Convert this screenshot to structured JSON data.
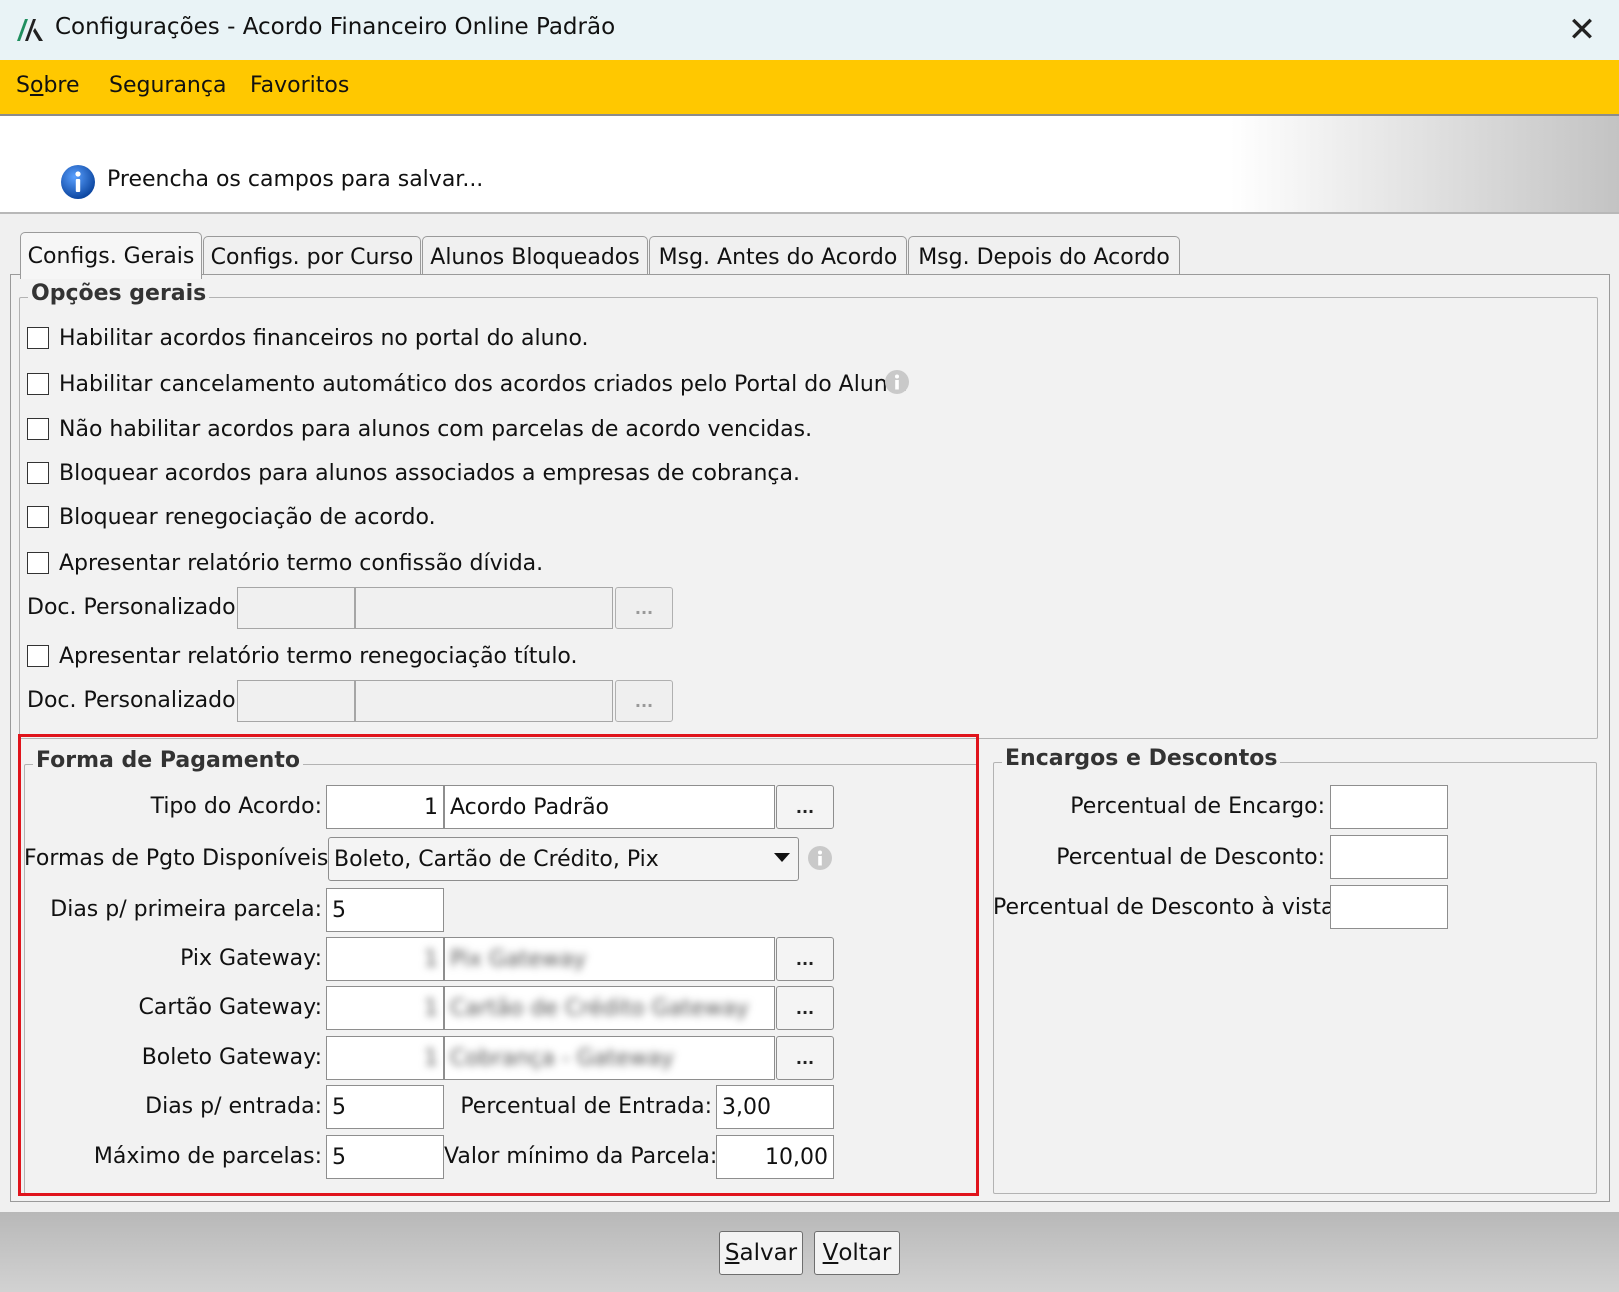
{
  "window": {
    "title": "Configurações - Acordo Financeiro Online Padrão",
    "close_glyph": "✕"
  },
  "menu": {
    "items": [
      {
        "pre": "S",
        "ul": "o",
        "post": "bre"
      },
      {
        "pre": "",
        "ul": "",
        "post": "Segurança"
      },
      {
        "pre": "",
        "ul": "",
        "post": "Favoritos"
      }
    ]
  },
  "banner": {
    "text": "Preencha os campos para salvar..."
  },
  "tabs": [
    {
      "label": "Configs. Gerais"
    },
    {
      "label": "Configs. por Curso"
    },
    {
      "label": "Alunos Bloqueados"
    },
    {
      "label": "Msg. Antes do Acordo"
    },
    {
      "label": "Msg. Depois do Acordo"
    }
  ],
  "opcoes_gerais": {
    "legend": "Opções gerais",
    "checkboxes": [
      {
        "label": "Habilitar acordos financeiros no portal do aluno.",
        "checked": false
      },
      {
        "label": "Habilitar cancelamento automático dos acordos criados pelo Portal do Aluno.",
        "checked": false
      },
      {
        "label": "Não habilitar acordos para alunos com parcelas de acordo vencidas.",
        "checked": false
      },
      {
        "label": "Bloquear acordos para alunos associados a empresas de cobrança.",
        "checked": false
      },
      {
        "label": "Bloquear renegociação de acordo.",
        "checked": false
      },
      {
        "label": "Apresentar relatório termo confissão dívida.",
        "checked": false
      },
      {
        "label": "Apresentar relatório termo renegociação título.",
        "checked": false
      }
    ],
    "doc_label": "Doc. Personalizado:",
    "dots": "..."
  },
  "forma_pagamento": {
    "legend": "Forma de Pagamento",
    "tipo_acordo_label": "Tipo do Acordo:",
    "tipo_acordo_code": "1",
    "tipo_acordo_name": "Acordo Padrão",
    "formas_label": "Formas de Pgto Disponíveis:",
    "formas_value": "Boleto, Cartão de Crédito, Pix",
    "dias_primeira_label": "Dias p/ primeira parcela:",
    "dias_primeira_value": "5",
    "pix_label": "Pix Gateway:",
    "pix_code": "1",
    "pix_name": "Pix Gateway",
    "cartao_label": "Cartão Gateway:",
    "cartao_code": "1",
    "cartao_name": "Cartão de Crédito Gateway",
    "boleto_label": "Boleto Gateway:",
    "boleto_code": "1",
    "boleto_name": "Cobrança - Gateway",
    "dias_entrada_label": "Dias p/ entrada:",
    "dias_entrada_value": "5",
    "perc_entrada_label": "Percentual de Entrada:",
    "perc_entrada_value": "3,00",
    "max_parcelas_label": "Máximo de parcelas:",
    "max_parcelas_value": "5",
    "valor_min_label": "Valor mínimo da Parcela:",
    "valor_min_value": "10,00",
    "dots": "..."
  },
  "encargos": {
    "legend": "Encargos e Descontos",
    "encargo_label": "Percentual de Encargo:",
    "encargo_value": "",
    "desconto_label": "Percentual de Desconto:",
    "desconto_value": "",
    "desconto_vista_label": "Percentual de Desconto à vista:",
    "desconto_vista_value": ""
  },
  "buttons": {
    "salvar": {
      "ul": "S",
      "rest": "alvar"
    },
    "voltar": {
      "ul": "V",
      "rest": "oltar"
    }
  },
  "colors": {
    "menubar": "#ffc800",
    "highlight": "#e0141c",
    "info_blue": "#1565c0"
  }
}
